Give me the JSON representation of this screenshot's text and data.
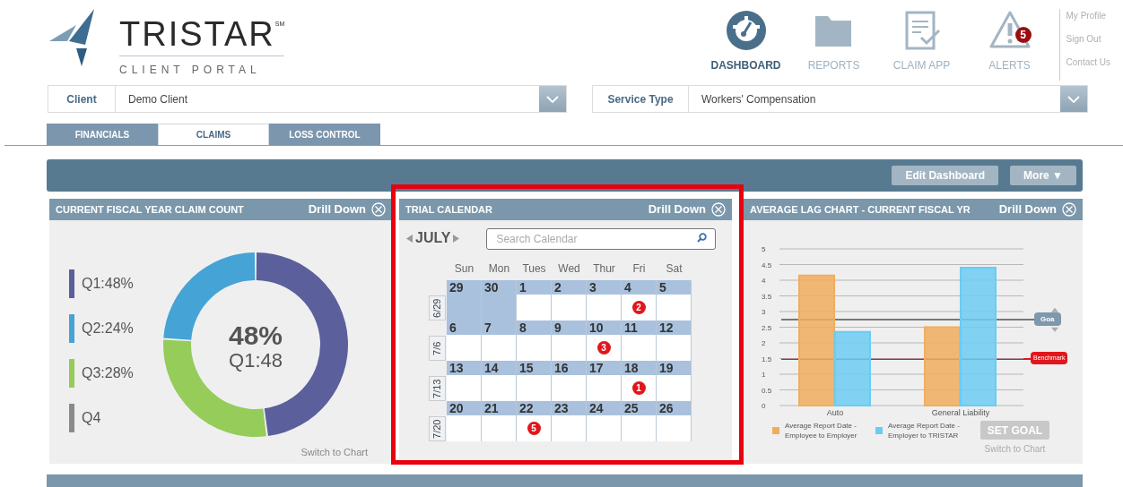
{
  "logo": {
    "name": "TRISTAR$^{SM}$",
    "subtitle": "CLIENT PORTAL"
  },
  "nav": [
    {
      "label": "DASHBOARD",
      "kind": "dashboard",
      "selected": true
    },
    {
      "label": "REPORTS",
      "kind": "reports",
      "selected": false
    },
    {
      "label": "CLAIM APP",
      "kind": "claim",
      "selected": false
    },
    {
      "label": "ALERTS",
      "kind": "alerts",
      "selected": false,
      "badge": "5"
    }
  ],
  "user_links": [
    "My Profile",
    "Sign Out",
    "Contact Us"
  ],
  "filters": [
    {
      "label": "Client",
      "value": "Demo Client"
    },
    {
      "label": "Service Type",
      "value": "Workers' Compensation"
    }
  ],
  "tabs": [
    {
      "label": "FINANCIALS",
      "selected": false
    },
    {
      "label": "CLAIMS",
      "selected": true
    },
    {
      "label": "LOSS CONTROL",
      "selected": false
    }
  ],
  "toolbar": {
    "buttons": [
      "Edit Dashboard",
      "More ▼"
    ]
  },
  "claim_count": {
    "title": "CURRENT FISCAL YEAR CLAIM COUNT",
    "action": "Drill Down",
    "legend": [
      {
        "color": "#5b5f9c"
      },
      {
        "color": "#45a3d5"
      },
      {
        "color": "#95cc5a"
      },
      {
        "color": "#8a8a8a"
      }
    ],
    "chart_data": {
      "type": "donut",
      "categories": [
        "Q1:48%",
        "Q2:24%",
        "Q3:28%",
        "Q4"
      ],
      "values": [
        48,
        24,
        28,
        null
      ]
    },
    "center_value": "48%",
    "center_label": "Q1:48",
    "switch_link": "Switch to Chart"
  },
  "trial_calendar": {
    "title": "TRIAL CALENDAR",
    "action": "Drill Down",
    "month": "JULY",
    "search_placeholder": "Search Calendar",
    "weekdays": [
      "Sun",
      "Mon",
      "Tues",
      "Wed",
      "Thur",
      "Fri",
      "Sat"
    ],
    "weeks": [
      {
        "label": "6/29",
        "days": [
          {
            "day": "29",
            "outside": true
          },
          {
            "day": "30",
            "outside": true
          },
          {
            "day": "1",
            "outside": false
          },
          {
            "day": "2",
            "outside": false
          },
          {
            "day": "3",
            "outside": false
          },
          {
            "day": "4",
            "outside": false,
            "events": "2"
          },
          {
            "day": "5",
            "outside": false
          }
        ]
      },
      {
        "label": "7/6",
        "days": [
          {
            "day": "6",
            "outside": false
          },
          {
            "day": "7",
            "outside": false
          },
          {
            "day": "8",
            "outside": false
          },
          {
            "day": "9",
            "outside": false
          },
          {
            "day": "10",
            "outside": false,
            "events": "3"
          },
          {
            "day": "11",
            "outside": false
          },
          {
            "day": "12",
            "outside": false
          }
        ]
      },
      {
        "label": "7/13",
        "days": [
          {
            "day": "13",
            "outside": false
          },
          {
            "day": "14",
            "outside": false
          },
          {
            "day": "15",
            "outside": false
          },
          {
            "day": "16",
            "outside": false
          },
          {
            "day": "17",
            "outside": false
          },
          {
            "day": "18",
            "outside": false,
            "events": "1"
          },
          {
            "day": "19",
            "outside": false
          }
        ]
      },
      {
        "label": "7/20",
        "days": [
          {
            "day": "20",
            "outside": false
          },
          {
            "day": "21",
            "outside": false
          },
          {
            "day": "22",
            "outside": false,
            "events": "5"
          },
          {
            "day": "23",
            "outside": false
          },
          {
            "day": "24",
            "outside": false
          },
          {
            "day": "25",
            "outside": false
          },
          {
            "day": "26",
            "outside": false
          }
        ]
      }
    ]
  },
  "lag_chart": {
    "title": "AVERAGE LAG CHART - CURRENT FISCAL YR",
    "action": "Drill Down",
    "chart_data": {
      "type": "bar",
      "categories": [
        "Auto",
        "General Liability"
      ],
      "series": [
        {
          "name": "Average Report Date - Employee to Employer",
          "color": "#f0ad5e",
          "values": [
            4.15,
            2.5
          ]
        },
        {
          "name": "Average Report Date - Employer to TRISTAR",
          "color": "#6ccbf2",
          "values": [
            2.35,
            4.4
          ]
        }
      ],
      "ylim": [
        0,
        5
      ],
      "yticks": [
        0,
        0.5,
        1,
        1.5,
        2,
        2.5,
        3,
        3.5,
        4,
        4.5,
        5
      ],
      "grid": true
    },
    "markers": [
      {
        "label": "Goa",
        "kind": "goal"
      },
      {
        "label": "Benchmark",
        "kind": "benchmark"
      }
    ],
    "set_goal": "SET GOAL",
    "switch_link": "Switch to Chart"
  },
  "highlight": true
}
